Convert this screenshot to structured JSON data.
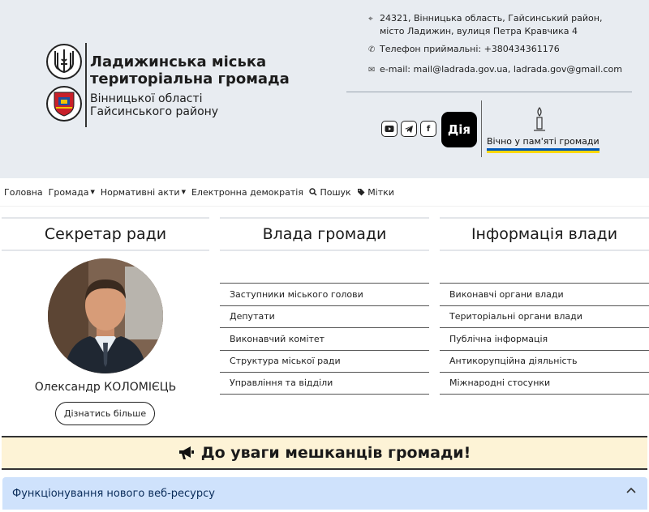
{
  "header": {
    "title": "Ладижинська міська територіальна громада",
    "subtitle": "Вінницької області Гайсинського району",
    "address_line1": "24321, Вінницька область, Гайсинський район,",
    "address_line2": "місто Ладижин, вулиця Петра Кравчика 4",
    "phone": "Телефон приймальні: +380434361176",
    "email": "e-mail: mail@ladrada.gov.ua, ladrada.gov@gmail.com",
    "diia_label": "Дія",
    "memory_link": "Вічно у пам'яті громади",
    "icons": [
      "map-pin-icon",
      "phone-icon",
      "email-icon",
      "youtube-icon",
      "telegram-icon",
      "facebook-icon",
      "candle-icon"
    ]
  },
  "nav": {
    "items": [
      {
        "label": "Головна",
        "dropdown": false
      },
      {
        "label": "Громада",
        "dropdown": true
      },
      {
        "label": "Нормативні акти",
        "dropdown": true
      },
      {
        "label": "Електронна демократія",
        "dropdown": false
      },
      {
        "label": "Пошук",
        "dropdown": false,
        "icon": "search-icon"
      },
      {
        "label": "Мітки",
        "dropdown": false,
        "icon": "tag-icon"
      }
    ]
  },
  "secretary": {
    "heading": "Секретар ради",
    "name": "Олександр КОЛОМІЄЦЬ",
    "button": "Дізнатись більше"
  },
  "authority": {
    "heading": "Влада громади",
    "links": [
      "Заступники міського голови",
      "Депутати",
      "Виконавчий комітет",
      "Структура міської ради",
      "Управління та відділи"
    ]
  },
  "info": {
    "heading": "Інформація влади",
    "links": [
      "Виконавчі органи влади",
      "Територіальні органи влади",
      "Публічна інформація",
      "Антикорупційна діяльність",
      "Міжнародні стосунки"
    ]
  },
  "banner": {
    "text": "До уваги мешканців громади!",
    "icon": "megaphone-icon"
  },
  "accordion": {
    "title": "Функціонування нового веб-ресурсу",
    "icon": "chevron-up-icon"
  },
  "colors": {
    "header_bg": "#e8ecf1",
    "banner_bg": "#fdf3d6",
    "accordion_bg": "#cfe2fc",
    "flag_blue": "#0057b8",
    "flag_yellow": "#ffd700"
  }
}
